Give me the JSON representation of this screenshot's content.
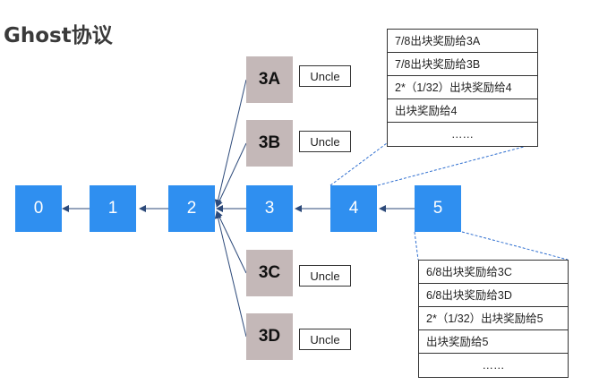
{
  "title": "Ghost协议",
  "blocks": [
    {
      "id": "b0",
      "label": "0"
    },
    {
      "id": "b1",
      "label": "1"
    },
    {
      "id": "b2",
      "label": "2"
    },
    {
      "id": "b3",
      "label": "3"
    },
    {
      "id": "b4",
      "label": "4"
    },
    {
      "id": "b5",
      "label": "5"
    }
  ],
  "uncles": [
    {
      "id": "u3a",
      "label": "3A",
      "tag": "Uncle"
    },
    {
      "id": "u3b",
      "label": "3B",
      "tag": "Uncle"
    },
    {
      "id": "u3c",
      "label": "3C",
      "tag": "Uncle"
    },
    {
      "id": "u3d",
      "label": "3D",
      "tag": "Uncle"
    }
  ],
  "reward_block4": [
    "7/8出块奖励给3A",
    "7/8出块奖励给3B",
    "2*（1/32）出块奖励给4",
    "出块奖励给4",
    "……"
  ],
  "reward_block5": [
    "6/8出块奖励给3C",
    "6/8出块奖励给3D",
    "2*（1/32）出块奖励给5",
    "出块奖励给5",
    "……"
  ],
  "colors": {
    "block": "#2f8ff0",
    "uncle": "#c4b8b8",
    "arrow": "#2d4a7a"
  }
}
